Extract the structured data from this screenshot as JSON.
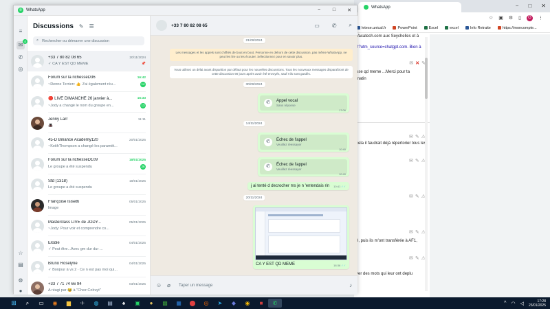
{
  "browser": {
    "tab_title": "WhatsApp",
    "profile_initial": "G",
    "bookmarks": [
      {
        "label": "letese.unical.fr"
      },
      {
        "label": "PowerPoint"
      },
      {
        "label": "Excel"
      },
      {
        "label": "excel"
      },
      {
        "label": "Info Retraite"
      },
      {
        "label": "https://moncompte..."
      }
    ],
    "content_lines": [
      "Vacatech.com aux Seychelles et à",
      "2?utm_source=chatgpt.com. Bien à",
      "ose qd meme ...Merci pour ta",
      "matin",
      "cela il faudrait déjà répertorier tous les",
      "3, puis ils m'ont transférée à AF1,",
      "yer des mots qui leur ont deplu"
    ]
  },
  "whatsapp": {
    "window_title": "WhatsApp",
    "list": {
      "title": "Discussions",
      "search_placeholder": "Rechercher ou démarrer une discussion",
      "chats": [
        {
          "name": "+33 7 80 82 08 65",
          "time": "20/11/2024",
          "preview": "✓ CA Y EST QD MEME",
          "unread": "",
          "pinned": true
        },
        {
          "name": "Forum sur la richesseD36",
          "time": "16:42",
          "preview": "~Renne Terrien: 👍 J'ai également réu...",
          "unread": "14",
          "pinned": false
        },
        {
          "name": "🔴 LIVE DIMANCHE 26 janvier à...",
          "time": "16:33",
          "preview": "~Jody a changé le nom du groupe en...",
          "unread": "13",
          "pinned": false
        },
        {
          "name": "Jenny Larr",
          "time": "11:11",
          "preview": "🎩",
          "unread": "",
          "pinned": false
        },
        {
          "name": "45-D Binance Academy120",
          "time": "20/01/2025",
          "preview": "~KeithThompson a changé les paramèt...",
          "unread": "",
          "pinned": false
        },
        {
          "name": "Forum sur la richesseD109",
          "time": "18/01/2025",
          "preview": "Le groupe a été suspendu",
          "unread": "26",
          "pinned": false
        },
        {
          "name": "Std (1318)",
          "time": "18/01/2025",
          "preview": "Le groupe a été suspendu",
          "unread": "",
          "pinned": false
        },
        {
          "name": "Françoise Isisetti",
          "time": "05/01/2025",
          "preview": "Image",
          "unread": "",
          "pinned": false
        },
        {
          "name": "Masterclass LIVE de JODY...",
          "time": "05/01/2025",
          "preview": "~Jody: Pour voir et comprendre co...",
          "unread": "",
          "pinned": false
        },
        {
          "name": "Élodie",
          "time": "04/01/2025",
          "preview": "✓ Peut être...Avec gm dur dur ...",
          "unread": "",
          "pinned": false
        },
        {
          "name": "Bruno Roselyne",
          "time": "04/01/2025",
          "preview": "✓ Bonjour à vs 2 · Ce n est pas moi qui...",
          "unread": "",
          "pinned": false
        },
        {
          "name": "+33 7 71 74 66 94",
          "time": "03/01/2025",
          "preview": "A réagi par 😂 à \"Chez Colruyt\"",
          "unread": "",
          "pinned": false
        }
      ]
    },
    "conversation": {
      "contact": "+33 7 80 82 08 65",
      "dates": [
        "21/09/2024",
        "30/09/2024",
        "14/11/2024",
        "20/11/2024"
      ],
      "system_encryption": "Les messages et les appels sont chiffrés de bout en bout. Personne en dehors de cette discussion, pas même WhatsApp, ne peut les lire ou les écouter. Sélectionnez pour en savoir plus.",
      "system_ephemeral": "Vous utilisez un délai avant disparition par défaut pour les nouvelles discussions. Tous les nouveaux messages disparaîtront de cette discussion 90 jours après avoir été envoyés, sauf s'ils sont gardés.",
      "calls": [
        {
          "title": "Appel vocal",
          "subtitle": "Sans réponse",
          "time": "17:06"
        },
        {
          "title": "Échec de l'appel",
          "subtitle": "Veuillez réessayer",
          "time": "10:40"
        },
        {
          "title": "Échec de l'appel",
          "subtitle": "Veuillez réessayer",
          "time": "10:40"
        }
      ],
      "text_message": {
        "text": "j ai tenté d decrocher ms je n 'entendais rin",
        "time": "10:41"
      },
      "image_message": {
        "caption": "CA Y EST QD MEME",
        "time": "18:36"
      },
      "composer_placeholder": "Taper un message"
    }
  },
  "taskbar": {
    "time": "17:28",
    "date": "23/01/2025"
  },
  "colors": {
    "accent": "#25d366",
    "outgoing_bubble": "#d9fdd3",
    "chat_bg": "#efeae2",
    "taskbar": "#0b1a2e"
  }
}
